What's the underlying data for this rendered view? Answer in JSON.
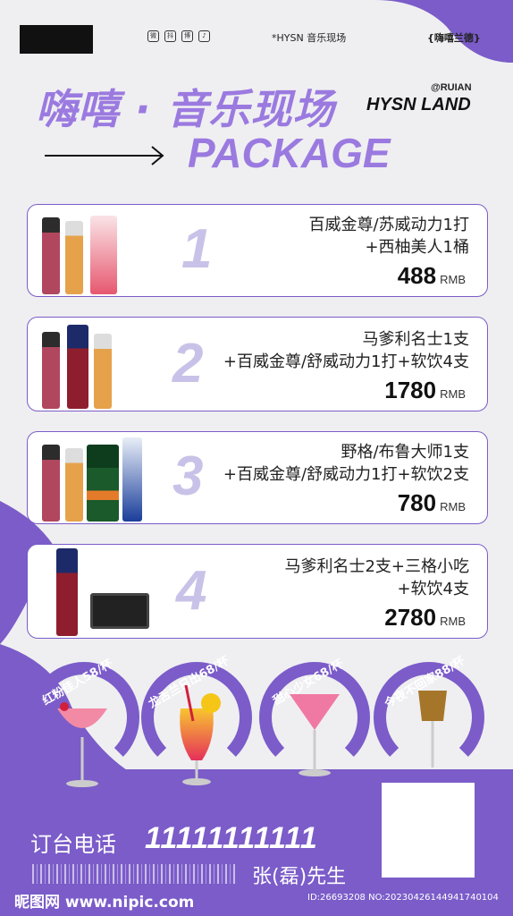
{
  "header": {
    "social_icons": [
      "wechat-icon",
      "douyin-icon",
      "weibo-icon",
      "tiktok-icon"
    ],
    "social_glyphs": [
      "微",
      "抖",
      "博",
      "♪"
    ],
    "center_text": "*HYSN 音乐现场",
    "right_text": "{嗨嘻兰德}",
    "title_cn": "嗨嘻 · 音乐现场",
    "ruian": "@RUIAN",
    "hysn_land": "HYSN LAND",
    "package": "PACKAGE"
  },
  "packages": [
    {
      "num": "1",
      "line1": "百威金尊/苏威动力1打",
      "line2": "+西柚美人1桶",
      "price": "488",
      "unit": "RMB"
    },
    {
      "num": "2",
      "line1": "马爹利名士1支",
      "line2": "+百威金尊/舒威动力1打+软饮4支",
      "price": "1780",
      "unit": "RMB"
    },
    {
      "num": "3",
      "line1": "野格/布鲁大师1支",
      "line2": "+百威金尊/舒威动力1打+软饮2支",
      "price": "780",
      "unit": "RMB"
    },
    {
      "num": "4",
      "line1": "马爹利名士2支+三格小吃",
      "line2": "+软饮4支",
      "price": "2780",
      "unit": "RMB"
    }
  ],
  "cocktails": [
    {
      "label": "红粉佳人58/杯"
    },
    {
      "label": "龙舌兰日出68/杯"
    },
    {
      "label": "甜心少女68/杯"
    },
    {
      "label": "今夜不回家88/杯"
    }
  ],
  "footer": {
    "call_label": "订台电话",
    "call_number": "11111111111",
    "contact": "张(磊)先生",
    "watermark_left": "昵图网 www.nipic.com",
    "watermark_right": "ID:26693208 NO:20230426144941740104"
  },
  "colors": {
    "accent": "#7b5cc9",
    "light": "#9b7ae0",
    "bg": "#efeff1"
  }
}
